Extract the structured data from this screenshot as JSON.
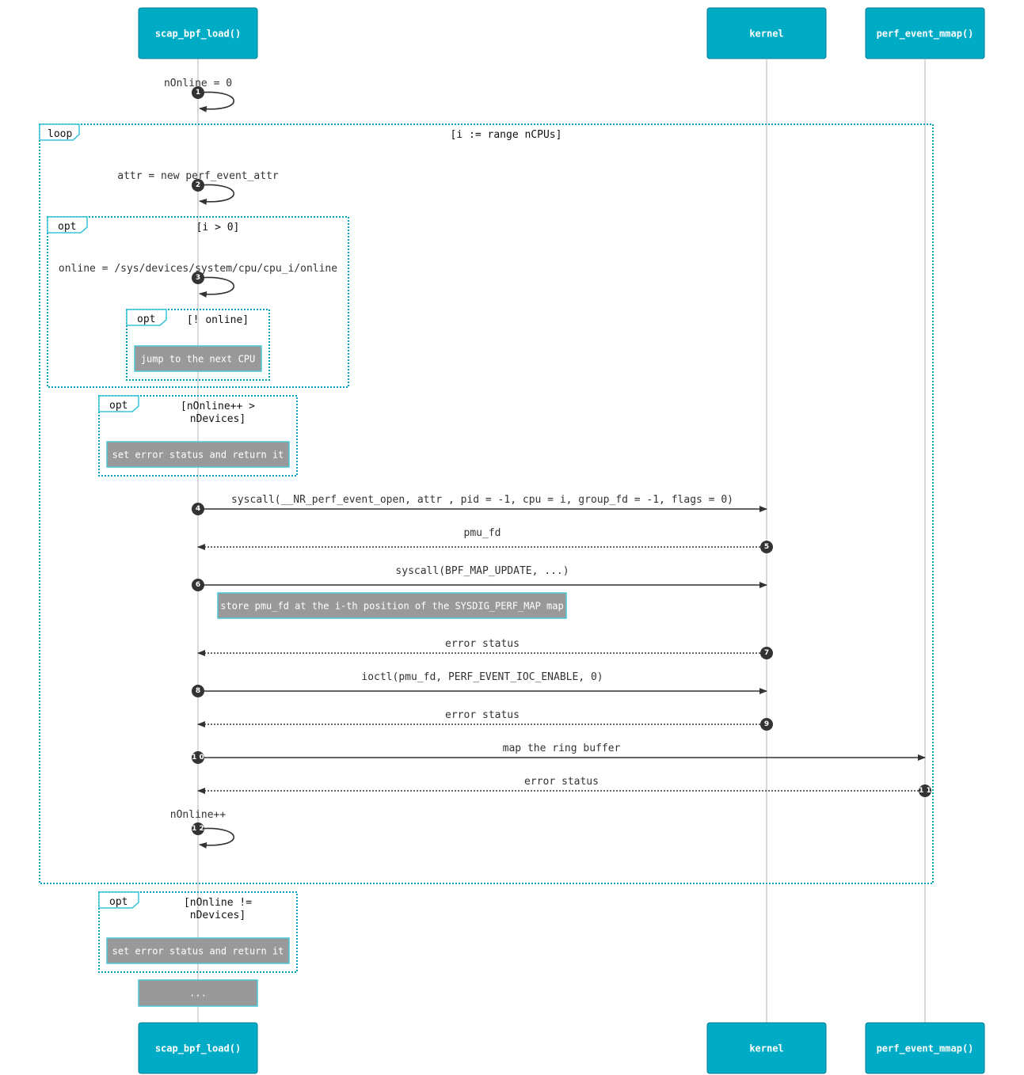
{
  "actors": [
    {
      "id": "scap",
      "label": "scap_bpf_load()"
    },
    {
      "id": "kernel",
      "label": "kernel"
    },
    {
      "id": "mmap",
      "label": "perf_event_mmap()"
    }
  ],
  "frames": [
    {
      "id": "loop",
      "type": "loop",
      "condition": [
        "[i := range nCPUs]"
      ]
    },
    {
      "id": "opt_i",
      "type": "opt",
      "condition": [
        "[i > 0]"
      ]
    },
    {
      "id": "opt_online",
      "type": "opt",
      "condition": [
        "[! online]"
      ]
    },
    {
      "id": "opt_ndev",
      "type": "opt",
      "condition": [
        "[nOnline++ >",
        "nDevices]"
      ]
    },
    {
      "id": "opt_final",
      "type": "opt",
      "condition": [
        "[nOnline !=",
        "nDevices]"
      ]
    }
  ],
  "messages": [
    {
      "seq": "1",
      "from": "scap",
      "to": "scap",
      "text": "nOnline = 0",
      "style": "self"
    },
    {
      "seq": "2",
      "from": "scap",
      "to": "scap",
      "text": "attr = new perf_event_attr",
      "style": "self"
    },
    {
      "seq": "3",
      "from": "scap",
      "to": "scap",
      "text": "online = /sys/devices/system/cpu/cpu_i/online",
      "style": "self"
    },
    {
      "seq": "4",
      "from": "scap",
      "to": "kernel",
      "text": "syscall(__NR_perf_event_open, attr , pid = -1, cpu = i, group_fd = -1, flags = 0)",
      "style": "solid"
    },
    {
      "seq": "5",
      "from": "kernel",
      "to": "scap",
      "text": "pmu_fd",
      "style": "dotted"
    },
    {
      "seq": "6",
      "from": "scap",
      "to": "kernel",
      "text": "syscall(BPF_MAP_UPDATE, ...)",
      "style": "solid"
    },
    {
      "seq": "7",
      "from": "kernel",
      "to": "scap",
      "text": "error status",
      "style": "dotted"
    },
    {
      "seq": "8",
      "from": "scap",
      "to": "kernel",
      "text": "ioctl(pmu_fd, PERF_EVENT_IOC_ENABLE, 0)",
      "style": "solid"
    },
    {
      "seq": "9",
      "from": "kernel",
      "to": "scap",
      "text": "error status",
      "style": "dotted"
    },
    {
      "seq": "1 0",
      "from": "scap",
      "to": "mmap",
      "text": "map the ring buffer",
      "style": "solid"
    },
    {
      "seq": "1 1",
      "from": "mmap",
      "to": "scap",
      "text": "error status",
      "style": "dotted"
    },
    {
      "seq": "1 2",
      "from": "scap",
      "to": "scap",
      "text": "nOnline++",
      "style": "self"
    }
  ],
  "notes": [
    {
      "id": "jump",
      "text": "jump to the next CPU"
    },
    {
      "id": "err1",
      "text": "set error status and return it"
    },
    {
      "id": "store",
      "text": "store pmu_fd at the i-th position of the SYSDIG_PERF_MAP map"
    },
    {
      "id": "err2",
      "text": "set error status and return it"
    },
    {
      "id": "ellipsis",
      "text": "..."
    }
  ]
}
